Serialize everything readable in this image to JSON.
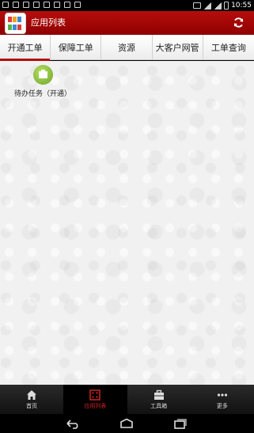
{
  "status_bar": {
    "time": "10:55"
  },
  "header": {
    "title": "应用列表"
  },
  "tabs": [
    {
      "label": "开通工单"
    },
    {
      "label": "保障工单"
    },
    {
      "label": "资源"
    },
    {
      "label": "大客户网管"
    },
    {
      "label": "工单查询"
    }
  ],
  "main": {
    "apps": [
      {
        "label": "待办任务（开通）"
      }
    ]
  },
  "bottom_nav": [
    {
      "label": "首页"
    },
    {
      "label": "应用列表"
    },
    {
      "label": "工具箱"
    },
    {
      "label": "更多"
    }
  ],
  "colors": {
    "accent": "#b30a0a",
    "app_icon": "#7cb83a"
  }
}
